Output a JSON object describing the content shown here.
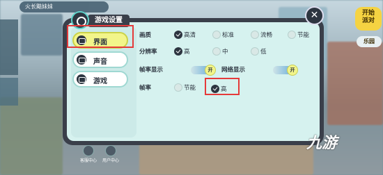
{
  "hud": {
    "top_text": "火长黯妹妹",
    "right_btn_1": "开始\n派对",
    "right_btn_2": "乐园"
  },
  "dialog": {
    "title": "游戏设置",
    "close": "✕",
    "tabs": [
      {
        "label": "界面",
        "active": true
      },
      {
        "label": "声音",
        "active": false
      },
      {
        "label": "游戏",
        "active": false
      }
    ],
    "settings": {
      "quality_label": "画质",
      "quality_options": [
        "高清",
        "标准",
        "流畅",
        "节能"
      ],
      "quality_selected": "高清",
      "resolution_label": "分辨率",
      "resolution_options": [
        "高",
        "中",
        "低"
      ],
      "resolution_selected": "高",
      "fps_display_label": "帧率显示",
      "fps_display_state": "开",
      "network_display_label": "网络显示",
      "network_display_state": "开",
      "framerate_label": "帧率",
      "framerate_options": [
        "节能",
        "高"
      ],
      "framerate_selected": "高"
    },
    "bottom": [
      {
        "label": "客服中心"
      },
      {
        "label": "用户中心"
      }
    ]
  },
  "watermark": "九游"
}
